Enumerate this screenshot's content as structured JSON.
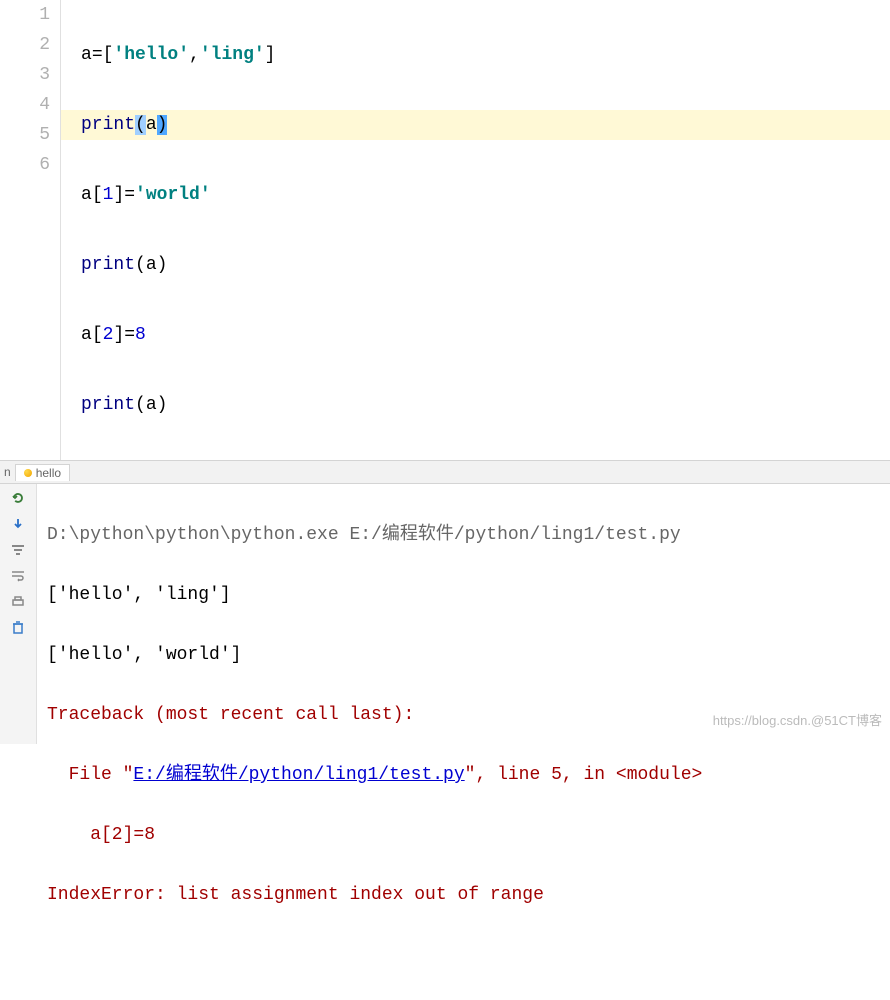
{
  "editor": {
    "line_numbers": [
      "1",
      "2",
      "3",
      "4",
      "5",
      "6"
    ],
    "highlight_index": 1,
    "lines": {
      "l1_var": "a",
      "l1_op": "=[",
      "l1_s1": "'hello'",
      "l1_comma": ",",
      "l1_s2": "'ling'",
      "l1_close": "]",
      "l2_fn": "print",
      "l2_open": "(",
      "l2_arg": "a",
      "l2_close": ")",
      "l3_var": "a",
      "l3_idx_open": "[",
      "l3_idx": "1",
      "l3_idx_close": "]=",
      "l3_val": "'world'",
      "l4_fn": "print",
      "l4_open": "(",
      "l4_arg": "a",
      "l4_close": ")",
      "l5_var": "a",
      "l5_idx_open": "[",
      "l5_idx": "2",
      "l5_idx_close": "]=",
      "l5_val": "8",
      "l6_fn": "print",
      "l6_open": "(",
      "l6_arg": "a",
      "l6_close": ")"
    }
  },
  "tab": {
    "prefix": "n",
    "name": "hello"
  },
  "console": {
    "cmd_a": "D:\\python\\python\\python.exe ",
    "cmd_b": "E:/编程软件/python/ling1/test.py",
    "out1": "['hello', 'ling']",
    "out2": "['hello', 'world']",
    "err_tb": "Traceback (most recent call last):",
    "err_file_pre": "  File \"",
    "err_file_link": "E:/编程软件/python/ling1/test.py",
    "err_file_post": "\", line 5, in <module>",
    "err_code": "    a[2]=8",
    "err_msg": "IndexError: list assignment index out of range"
  },
  "watermark": "https://blog.csdn.@51CT博客"
}
